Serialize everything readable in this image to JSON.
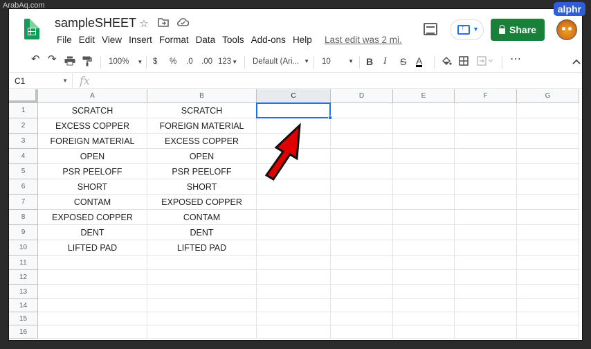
{
  "watermark": "ArabAq.com",
  "brand": "alphr",
  "doc": {
    "title": "sampleSHEET",
    "star_icon": "star-icon",
    "move_icon": "folder-move-icon",
    "cloud_icon": "cloud-status-icon"
  },
  "menu": [
    "File",
    "Edit",
    "View",
    "Insert",
    "Format",
    "Data",
    "Tools",
    "Add-ons",
    "Help"
  ],
  "last_edit": "Last edit was 2 mi...",
  "share_label": "Share",
  "toolbar": {
    "zoom": "100%",
    "currency": "$",
    "percent": "%",
    "dec_less": ".0",
    "dec_more": ".00",
    "format_more": "123",
    "font": "Default (Ari...",
    "font_size": "10",
    "bold": "B",
    "italic": "I",
    "strike": "S",
    "text_color_letter": "A",
    "more": "⋯"
  },
  "namebox": "C1",
  "fx": "fx",
  "columns": [
    "A",
    "B",
    "C",
    "D",
    "E",
    "F",
    "G"
  ],
  "rows": [
    "1",
    "2",
    "3",
    "4",
    "5",
    "6",
    "7",
    "8",
    "9",
    "10",
    "11",
    "12",
    "13",
    "14",
    "15",
    "16"
  ],
  "cells": {
    "A": [
      "SCRATCH",
      "EXCESS COPPER",
      "FOREIGN MATERIAL",
      "OPEN",
      "PSR PEELOFF",
      "SHORT",
      "CONTAM",
      "EXPOSED COPPER",
      "DENT",
      "LIFTED PAD",
      "",
      "",
      "",
      "",
      "",
      ""
    ],
    "B": [
      "SCRATCH",
      "FOREIGN MATERIAL",
      "EXCESS COPPER",
      "OPEN",
      "PSR PEELOFF",
      "SHORT",
      "EXPOSED COPPER",
      "CONTAM",
      "DENT",
      "LIFTED PAD",
      "",
      "",
      "",
      "",
      "",
      ""
    ]
  },
  "selected_cell": "C1",
  "colors": {
    "share_green": "#188038",
    "accent_blue": "#1a73e8",
    "arrow_red": "#e00000"
  }
}
